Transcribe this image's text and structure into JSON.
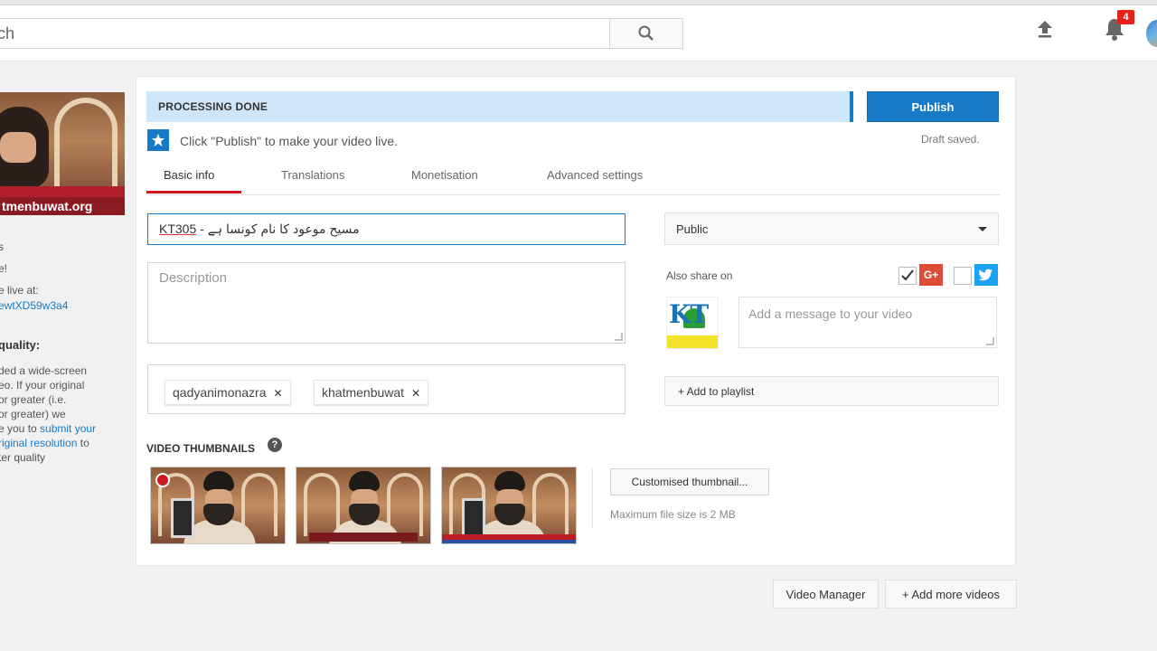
{
  "header": {
    "search_placeholder": "ch",
    "notification_count": "4"
  },
  "left_panel": {
    "thumbnail_url_text": "tmenbuwat.org",
    "lines": [
      "s",
      "e!"
    ],
    "live_at_label": "e live at:",
    "video_link": "ewtXD59w3a4",
    "quality_heading": "quality:",
    "quality_text_lines": [
      "ded a wide-screen",
      "eo. If your original",
      "or greater (i.e.",
      "or greater) we",
      "e you to",
      "riginal resolution",
      "ter quality"
    ],
    "submit_link_text": "submit your",
    "to_text": "to"
  },
  "status": {
    "processing": "PROCESSING DONE",
    "publish_label": "Publish",
    "hint": "Click \"Publish\" to make your video live.",
    "draft_saved": "Draft saved."
  },
  "tabs": [
    {
      "label": "Basic info",
      "active": true
    },
    {
      "label": "Translations",
      "active": false
    },
    {
      "label": "Monetisation",
      "active": false
    },
    {
      "label": "Advanced settings",
      "active": false
    }
  ],
  "form": {
    "title_code": "KT305",
    "title_separator": " - ",
    "title_text": "مسیح موعود کا نام کونسا ہے",
    "description_placeholder": "Description",
    "tags": [
      "qadyanimonazra",
      "khatmenbuwat"
    ]
  },
  "thumbnails": {
    "title": "VIDEO THUMBNAILS",
    "help_glyph": "?",
    "custom_button": "Customised thumbnail...",
    "max_size": "Maximum file size is 2 MB"
  },
  "sidebar": {
    "privacy": "Public",
    "also_share": "Also share on",
    "message_placeholder": "Add a message to your video",
    "gplus_label": "G+",
    "channel_initials": "KT",
    "add_playlist": "+ Add to playlist"
  },
  "footer": {
    "video_manager": "Video Manager",
    "add_more": "+ Add more videos"
  },
  "colors": {
    "accent_blue": "#167ac6",
    "processing_bg": "#cfe6f8",
    "tab_red": "#cc181e",
    "gplus_red": "#dd4b39",
    "twitter_blue": "#1da1f2"
  }
}
